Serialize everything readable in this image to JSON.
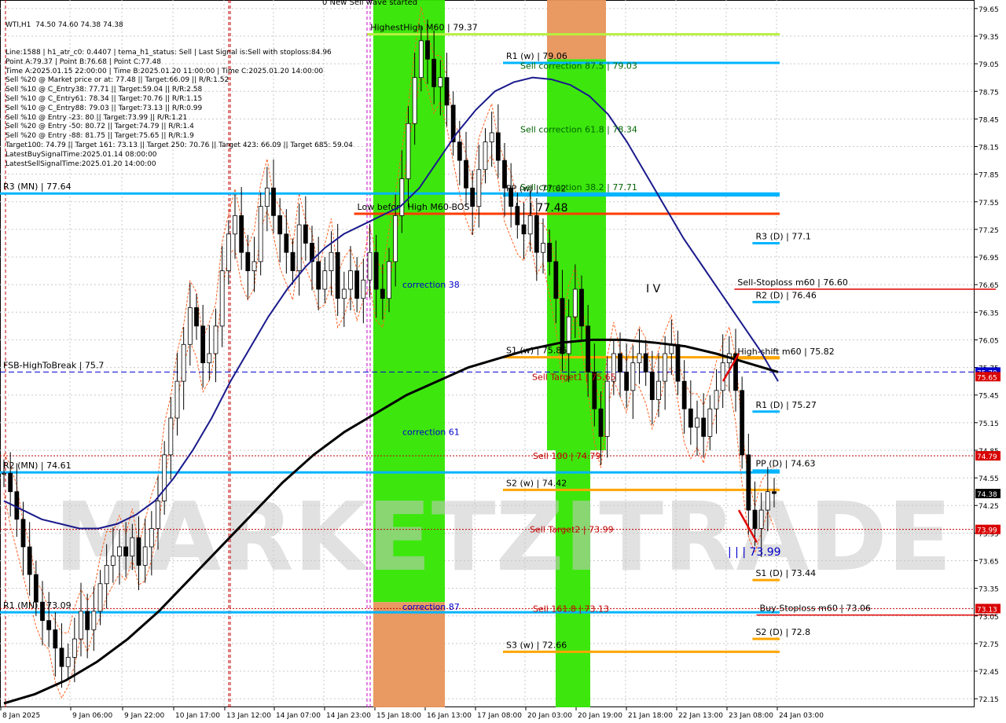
{
  "window": {
    "symbol_line": "WTI,H1  74.50 74.60 74.38 74.38"
  },
  "info_lines": [
    "Line:1588 | h1_atr_c0: 0.4407 | tema_h1_status: Sell | Last Signal is:Sell with stoploss:84.96",
    "Point A:79.37 | Point B:76.68 | Point C:77.48",
    "Time A:2025.01.15 22:00:00 | Time B:2025.01.20 11:00:00 | Time C:2025.01.20 14:00:00",
    "Sell %20 @ Market price or at: 77.48 || Target:66.09 || R/R:1.52",
    "Sell %10 @ C_Entry38: 77.71 || Target:59.04 || R/R:2.58",
    "Sell %10 @ C_Entry61: 78.34 || Target:70.76 || R/R:1.15",
    "Sell %10 @ C_Entry88: 79.03 || Target:73.13 || R/R:0.99",
    "Sell %10 @ Entry -23: 80 || Target:73.99 || R/R:1.21",
    "Sell %20 @ Entry -50: 80.72 || Target:74.79 || R/R:1.4",
    "Sell %20 @ Entry -88: 81.75 || Target:75.65 || R/R:1.9",
    "Target100: 74.79 || Target 161: 73.13 || Target 250: 70.76 || Target 423: 66.09 || Target 685: 59.04",
    "LatestBuySignalTime:2025.01.14 08:00:00",
    "LatestSellSignalTime:2025.01.20 14:00:00"
  ],
  "watermark": "MARKETZITRADE",
  "top_label": "0 New Sell wave started",
  "chart_data": {
    "type": "line",
    "title": "WTI,H1",
    "xlabel": "",
    "ylabel": "",
    "ylim": [
      72.1,
      79.7
    ],
    "grid": true,
    "x_ticks": [
      "8 Jan 2025",
      "9 Jan 06:00",
      "9 Jan 22:00",
      "10 Jan 17:00",
      "13 Jan 12:00",
      "14 Jan 07:00",
      "14 Jan 23:00",
      "15 Jan 18:00",
      "16 Jan 13:00",
      "17 Jan 08:00",
      "20 Jan 03:00",
      "20 Jan 19:00",
      "21 Jan 18:00",
      "22 Jan 13:00",
      "23 Jan 08:00",
      "24 Jan 03:00"
    ],
    "y_ticks": [
      79.65,
      79.35,
      79.05,
      78.75,
      78.45,
      78.15,
      77.85,
      77.55,
      77.25,
      76.95,
      76.65,
      76.35,
      76.05,
      75.75,
      75.45,
      75.15,
      74.85,
      74.55,
      74.25,
      73.95,
      73.65,
      73.35,
      73.05,
      72.75,
      72.45,
      72.15
    ],
    "price_close": [
      74.6,
      74.4,
      74.1,
      73.8,
      73.5,
      73.2,
      73.0,
      72.9,
      72.7,
      72.5,
      72.6,
      72.8,
      73.1,
      72.9,
      73.1,
      73.4,
      73.6,
      73.7,
      73.8,
      73.7,
      73.9,
      73.6,
      73.8,
      74.0,
      74.3,
      74.8,
      75.2,
      75.6,
      76.0,
      76.4,
      76.2,
      75.8,
      75.9,
      76.2,
      76.8,
      77.2,
      77.4,
      77.0,
      76.8,
      76.9,
      77.5,
      77.7,
      77.4,
      77.2,
      77.0,
      76.8,
      77.3,
      77.1,
      76.9,
      76.6,
      76.8,
      77.0,
      76.5,
      76.6,
      76.8,
      76.5,
      76.7,
      77.0,
      76.6,
      76.5,
      76.9,
      77.4,
      77.8,
      78.4,
      78.9,
      79.3,
      79.1,
      78.8,
      78.9,
      78.6,
      78.2,
      78.0,
      77.7,
      77.5,
      77.9,
      78.2,
      78.3,
      78.0,
      77.7,
      77.5,
      77.3,
      77.2,
      77.4,
      77.0,
      77.1,
      76.9,
      76.5,
      75.9,
      76.3,
      76.6,
      76.2,
      75.7,
      75.3,
      75.0,
      75.6,
      75.9,
      75.7,
      75.5,
      75.8,
      75.9,
      75.7,
      75.4,
      75.6,
      75.9,
      76.0,
      75.6,
      75.3,
      75.1,
      75.2,
      75.0,
      75.3,
      75.5,
      75.8,
      75.9,
      75.5,
      74.8,
      74.2,
      74.0,
      74.2,
      74.4,
      74.38
    ],
    "series": [
      {
        "name": "MA fast (navy)",
        "color": "#1a1a8c",
        "values": [
          74.3,
          74.2,
          74.1,
          74.05,
          74.0,
          74.0,
          74.05,
          74.15,
          74.3,
          74.55,
          74.85,
          75.2,
          75.6,
          75.95,
          76.3,
          76.6,
          76.85,
          77.05,
          77.2,
          77.3,
          77.4,
          77.5,
          77.7,
          78.0,
          78.3,
          78.55,
          78.75,
          78.85,
          78.9,
          78.88,
          78.82,
          78.7,
          78.5,
          78.2,
          77.85,
          77.5,
          77.15,
          76.85,
          76.55,
          76.25,
          75.95,
          75.6
        ]
      },
      {
        "name": "MA slow (black)",
        "color": "#000000",
        "values": [
          72.1,
          72.2,
          72.35,
          72.55,
          72.8,
          73.1,
          73.45,
          73.8,
          74.15,
          74.5,
          74.8,
          75.05,
          75.25,
          75.45,
          75.6,
          75.75,
          75.85,
          75.95,
          76.02,
          76.05,
          76.05,
          76.02,
          75.98,
          75.9,
          75.8,
          75.7
        ]
      }
    ],
    "price_labels": [
      {
        "value": 75.7,
        "text": "75.70",
        "bg": "#0000cc"
      },
      {
        "value": 75.65,
        "text": "75.65",
        "bg": "#d80000"
      },
      {
        "value": 74.79,
        "text": "74.79",
        "bg": "#d80000"
      },
      {
        "value": 74.38,
        "text": "74.38",
        "bg": "#000000"
      },
      {
        "value": 73.99,
        "text": "73.99",
        "bg": "#d80000"
      },
      {
        "value": 73.13,
        "text": "73.13",
        "bg": "#d80000"
      }
    ],
    "levels": [
      {
        "label": "HighestHigh   M60 | 79.37",
        "value": 79.37,
        "color": "#b8f040",
        "x0": 0.365,
        "x1": 0.775
      },
      {
        "label": "R1 (w) | 79.06",
        "value": 79.06,
        "color": "#00b4ff",
        "x0": 0.5,
        "x1": 0.775
      },
      {
        "label": "R3 (MN) | 77.64",
        "value": 77.64,
        "color": "#00b4ff",
        "x0": 0.0,
        "x1": 0.775
      },
      {
        "label": "PP (w) | 77.62",
        "value": 77.62,
        "color": "#00b4ff",
        "x0": 0.5,
        "x1": 0.775
      },
      {
        "label": "Low before High   M60-BOS",
        "value": 77.42,
        "color": "#ff3c00",
        "x0": 0.352,
        "x1": 0.775
      },
      {
        "label": "R3 (D) | 77.1",
        "value": 77.1,
        "color": "#00b4ff",
        "x0": 0.748,
        "x1": 0.775
      },
      {
        "label": "Sell-Stoploss m60 | 76.60",
        "value": 76.6,
        "color": "#e00000",
        "x0": 0.73,
        "x1": 0.99
      },
      {
        "label": "R2 (D) | 76.46",
        "value": 76.46,
        "color": "#00b4ff",
        "x0": 0.748,
        "x1": 0.775
      },
      {
        "label": "S1 (w) | 75.86",
        "value": 75.86,
        "color": "#ffa500",
        "x0": 0.5,
        "x1": 0.775
      },
      {
        "label": "High-shift m60 | 75.82",
        "value": 75.85,
        "color": "#ffa500",
        "x0": 0.73,
        "x1": 0.775
      },
      {
        "label": "FSB-HighToBreak | 75.7",
        "value": 75.7,
        "color": "#0000cc",
        "x0": 0.0,
        "x1": 0.99,
        "dashed": true
      },
      {
        "label": "R1 (D) | 75.27",
        "value": 75.27,
        "color": "#00b4ff",
        "x0": 0.748,
        "x1": 0.775
      },
      {
        "label": "PP (D) | 74.63",
        "value": 74.63,
        "color": "#00b4ff",
        "x0": 0.748,
        "x1": 0.775
      },
      {
        "label": "R2 (MN) | 74.61",
        "value": 74.61,
        "color": "#00b4ff",
        "x0": 0.0,
        "x1": 0.775
      },
      {
        "label": "S2 (w) | 74.42",
        "value": 74.42,
        "color": "#ffa500",
        "x0": 0.5,
        "x1": 0.775
      },
      {
        "label": "S1 (D) | 73.44",
        "value": 73.44,
        "color": "#ffa500",
        "x0": 0.748,
        "x1": 0.775
      },
      {
        "label": "R1 (MN) | 73.09",
        "value": 73.09,
        "color": "#00b4ff",
        "x0": 0.0,
        "x1": 0.775
      },
      {
        "label": "Buy-Stoploss m60 | 73.06",
        "value": 73.06,
        "color": "#e00000",
        "x0": 0.752,
        "x1": 0.99
      },
      {
        "label": "S2 (D) | 72.8",
        "value": 72.8,
        "color": "#ffa500",
        "x0": 0.748,
        "x1": 0.775
      },
      {
        "label": "S3 (w) | 72.66",
        "value": 72.66,
        "color": "#ffa500",
        "x0": 0.5,
        "x1": 0.775
      }
    ],
    "annotations": [
      {
        "text": "Sell correction 87.5 | 79.03",
        "value": 79.03,
        "color": "#006400"
      },
      {
        "text": "Sell correction 61.8 | 78.34",
        "value": 78.34,
        "color": "#006400"
      },
      {
        "text": "Sell correction 38.2 | 77.71",
        "value": 77.71,
        "color": "#006400"
      },
      {
        "text": "| | | 77.48",
        "value": 77.48,
        "color": "#000000"
      },
      {
        "text": "I V",
        "value": 76.6,
        "color": "#000000"
      },
      {
        "text": "Sell Target1 | 75.65",
        "value": 75.65,
        "color": "#c00000"
      },
      {
        "text": "Sell 100 | 74.79",
        "value": 74.79,
        "color": "#c00000"
      },
      {
        "text": "Sell Target2 | 73.99",
        "value": 73.99,
        "color": "#c00000"
      },
      {
        "text": "| | | 73.99",
        "value": 73.74,
        "color": "#0000cc"
      },
      {
        "text": "Sell 161.8 | 73.13",
        "value": 73.13,
        "color": "#c00000"
      },
      {
        "text": "correction 38",
        "value": 76.65,
        "color": "#0000cc"
      },
      {
        "text": "correction 61",
        "value": 75.05,
        "color": "#0000cc"
      },
      {
        "text": "correction 87",
        "value": 73.15,
        "color": "#0000cc"
      }
    ],
    "zones": [
      {
        "name": "green-zone-1",
        "color": "#33e600",
        "from": 79.7,
        "to": 72.1
      },
      {
        "name": "orange-zone-1",
        "color": "#e8935a",
        "from": 73.2,
        "to": 72.1
      },
      {
        "name": "orange-zone-2",
        "color": "#e8935a",
        "from": 79.7,
        "to": 79.1
      },
      {
        "name": "green-zone-2",
        "color": "#33e600",
        "from": 79.1,
        "to": 74.85
      },
      {
        "name": "green-zone-3",
        "color": "#33e600",
        "from": 74.85,
        "to": 72.1
      }
    ]
  }
}
